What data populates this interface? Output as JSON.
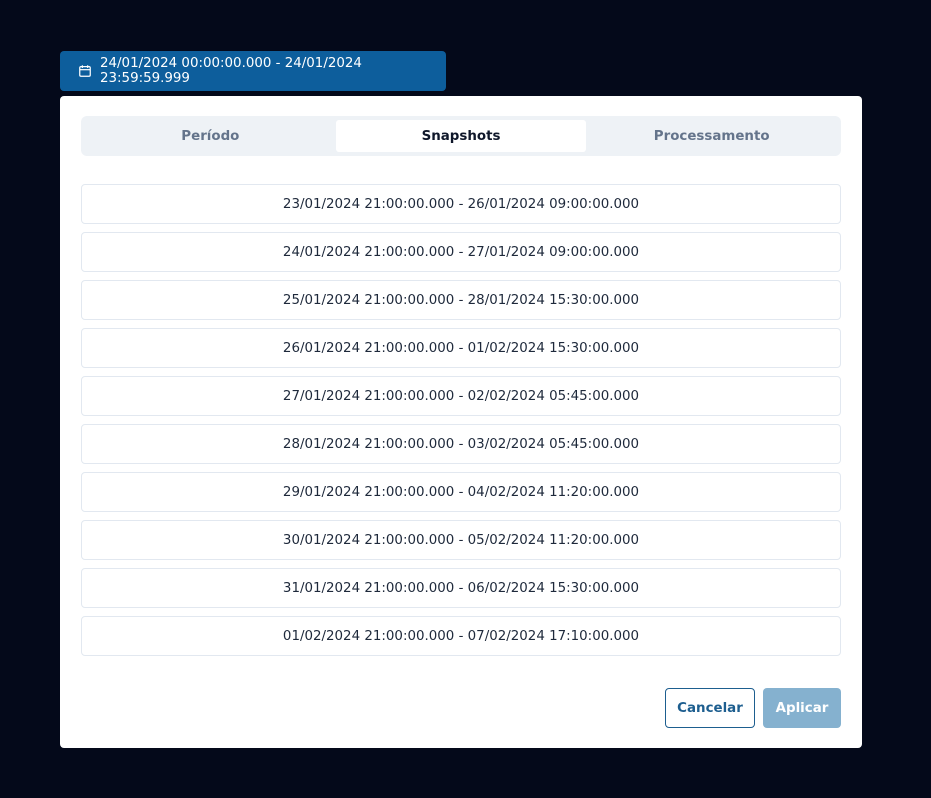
{
  "trigger": {
    "icon": "calendar-icon",
    "label": "24/01/2024 00:00:00.000 - 24/01/2024 23:59:59.999"
  },
  "tabs": [
    {
      "label": "Período",
      "active": false
    },
    {
      "label": "Snapshots",
      "active": true
    },
    {
      "label": "Processamento",
      "active": false
    }
  ],
  "snapshots": [
    "23/01/2024 21:00:00.000 - 26/01/2024 09:00:00.000",
    "24/01/2024 21:00:00.000 - 27/01/2024 09:00:00.000",
    "25/01/2024 21:00:00.000 - 28/01/2024 15:30:00.000",
    "26/01/2024 21:00:00.000 - 01/02/2024 15:30:00.000",
    "27/01/2024 21:00:00.000 - 02/02/2024 05:45:00.000",
    "28/01/2024 21:00:00.000 - 03/02/2024 05:45:00.000",
    "29/01/2024 21:00:00.000 - 04/02/2024 11:20:00.000",
    "30/01/2024 21:00:00.000 - 05/02/2024 11:20:00.000",
    "31/01/2024 21:00:00.000 - 06/02/2024 15:30:00.000",
    "01/02/2024 21:00:00.000 - 07/02/2024 17:10:00.000"
  ],
  "actions": {
    "cancel_label": "Cancelar",
    "apply_label": "Aplicar"
  },
  "colors": {
    "trigger_bg": "#0d5e9c",
    "page_bg": "#04091a",
    "apply_disabled_bg": "#85b1cf",
    "cancel_border": "#1d5e8f"
  }
}
